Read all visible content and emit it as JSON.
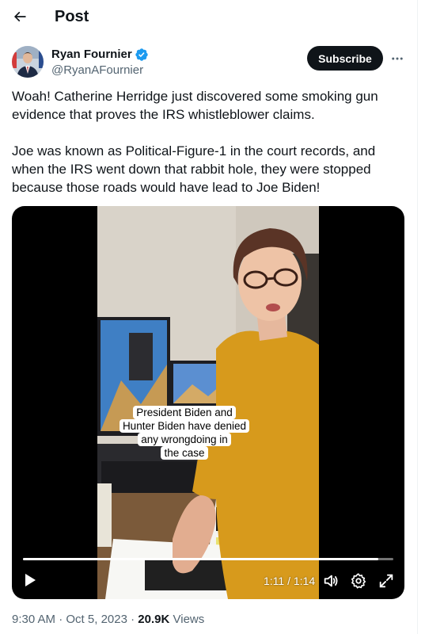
{
  "header": {
    "title": "Post"
  },
  "author": {
    "name": "Ryan Fournier",
    "handle": "@RyanAFournier",
    "verified_color": "#1d9bf0"
  },
  "actions": {
    "subscribe_label": "Subscribe"
  },
  "tweet": {
    "paragraphs": [
      "Woah! Catherine Herridge just discovered some smoking gun evidence that proves the IRS whistleblower claims.",
      "Joe was known as Political-Figure-1 in the court records, and when the IRS went down that rabbit hole, they were stopped because those roads would have lead to Joe Biden!"
    ]
  },
  "video": {
    "caption_lines": [
      "President Biden and",
      "Hunter Biden have denied",
      "any wrongdoing in",
      "the case"
    ],
    "timecode": "1:11 / 1:14",
    "progress_fraction": 0.96
  },
  "meta": {
    "time": "9:30 AM",
    "separator": "·",
    "date": "Oct 5, 2023",
    "views_count": "20.9K",
    "views_label": "Views"
  },
  "colors": {
    "text_primary": "#0f1419",
    "text_secondary": "#536471",
    "accent": "#1d9bf0",
    "button_dark": "#0f1419"
  },
  "icons": {
    "back": "arrow-left-icon",
    "verified": "verified-badge-icon",
    "more": "more-dots-icon",
    "play": "play-icon",
    "volume": "volume-icon",
    "settings": "gear-icon",
    "fullscreen": "fullscreen-icon"
  }
}
